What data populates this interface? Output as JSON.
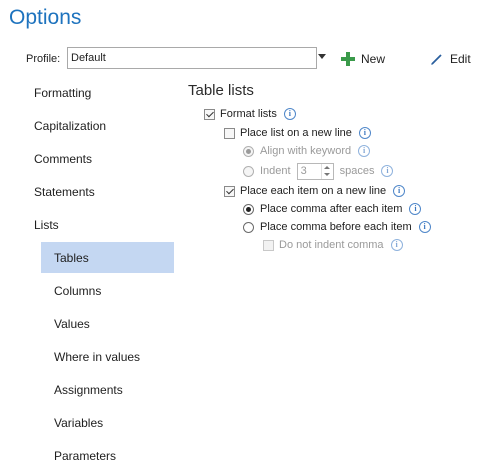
{
  "window": {
    "title": "Options"
  },
  "profile": {
    "label": "Profile:",
    "value": "Default",
    "new_label": "New",
    "edit_label": "Edit"
  },
  "nav": {
    "items": [
      {
        "label": "Formatting"
      },
      {
        "label": "Capitalization"
      },
      {
        "label": "Comments"
      },
      {
        "label": "Statements"
      },
      {
        "label": "Lists"
      },
      {
        "label": "Tables"
      },
      {
        "label": "Columns"
      },
      {
        "label": "Values"
      },
      {
        "label": "Where in values"
      },
      {
        "label": "Assignments"
      },
      {
        "label": "Variables"
      },
      {
        "label": "Parameters"
      }
    ],
    "selected": "Tables"
  },
  "panel": {
    "title": "Table lists",
    "format_lists": "Format lists",
    "place_list_new_line": "Place list on a new line",
    "align_with_keyword": "Align with keyword",
    "indent": "Indent",
    "indent_value": "3",
    "spaces": "spaces",
    "place_each_item_new_line": "Place each item on a new line",
    "comma_after": "Place comma after each item",
    "comma_before": "Place comma before each item",
    "do_not_indent_comma": "Do not indent comma",
    "info_glyph": "i"
  },
  "colors": {
    "title": "#1e73be",
    "selected_bg": "#c4d7f2",
    "new_icon": "#3a9a4a",
    "info": "#3b77c0"
  }
}
